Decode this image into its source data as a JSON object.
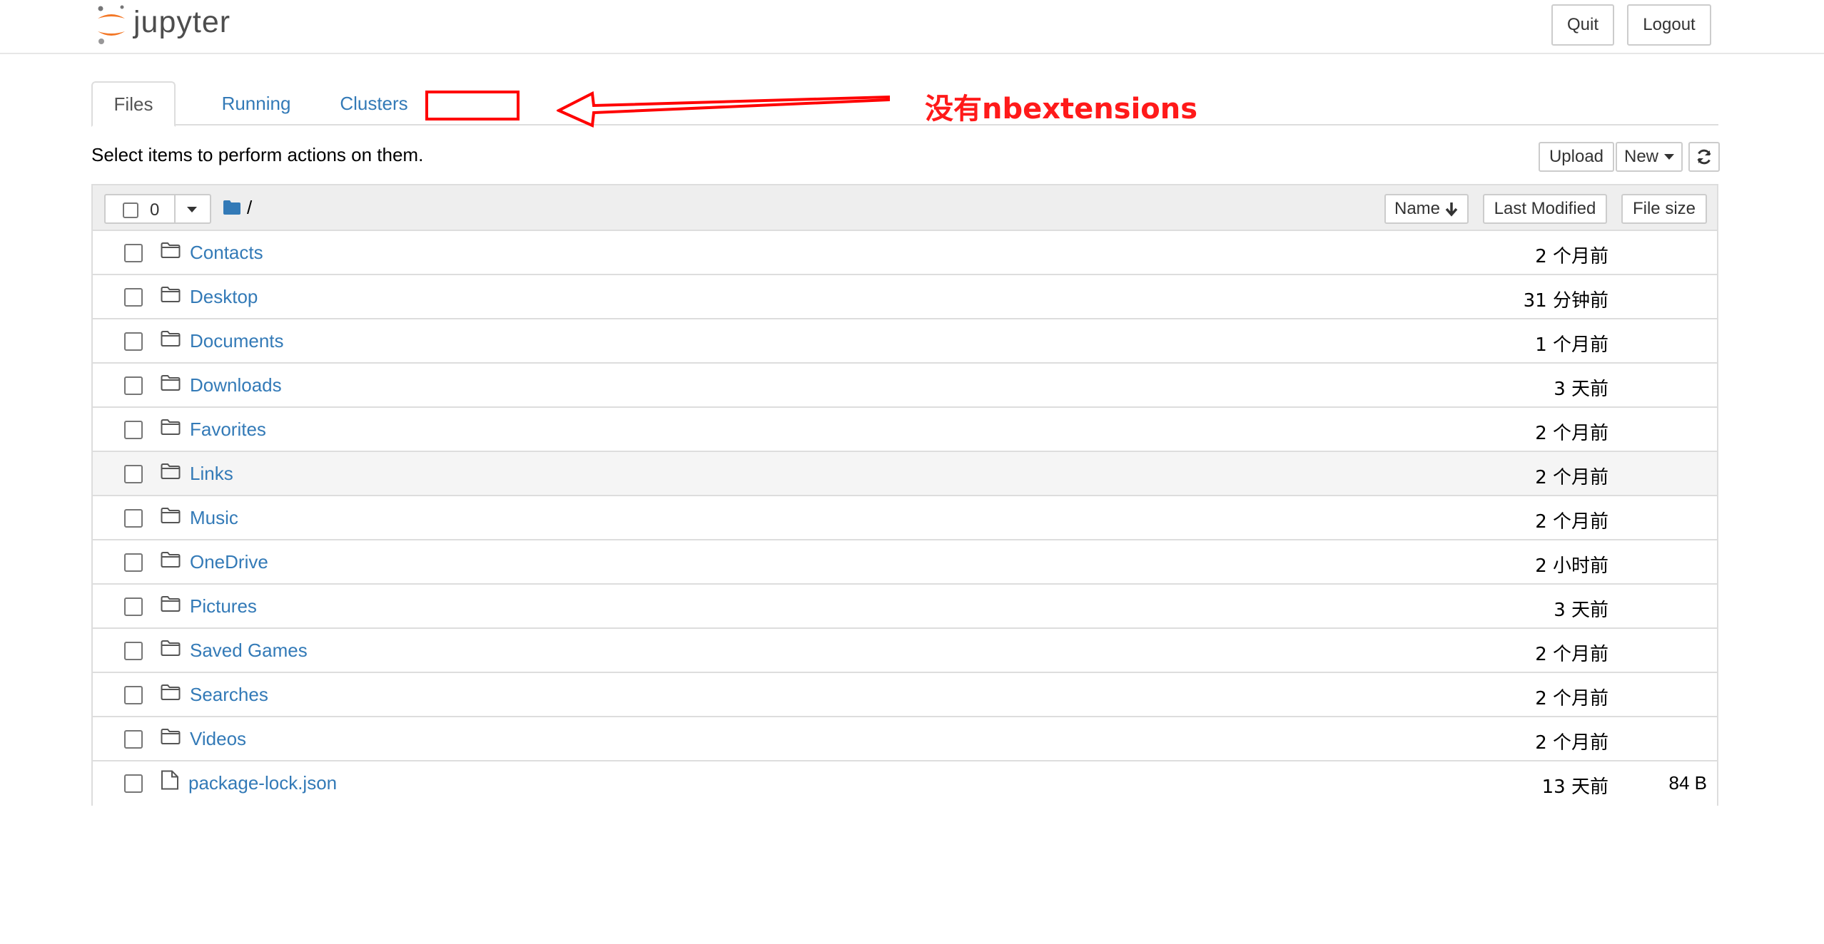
{
  "header": {
    "logo_text": "jupyter",
    "quit_label": "Quit",
    "logout_label": "Logout"
  },
  "tabs": [
    {
      "label": "Files",
      "active": true
    },
    {
      "label": "Running",
      "active": false
    },
    {
      "label": "Clusters",
      "active": false
    }
  ],
  "annotation": {
    "text": "没有nbextensions",
    "color": "#ff0000"
  },
  "toolbar": {
    "hint": "Select items to perform actions on them.",
    "upload_label": "Upload",
    "new_label": "New",
    "refresh_icon": "refresh-icon"
  },
  "list_header": {
    "selected_count": "0",
    "breadcrumb": "/",
    "sort_name_label": "Name",
    "sort_modified_label": "Last Modified",
    "sort_size_label": "File size"
  },
  "rows": [
    {
      "name": "Contacts",
      "type": "folder",
      "modified": "2 个月前",
      "size": ""
    },
    {
      "name": "Desktop",
      "type": "folder",
      "modified": "31 分钟前",
      "size": ""
    },
    {
      "name": "Documents",
      "type": "folder",
      "modified": "1 个月前",
      "size": ""
    },
    {
      "name": "Downloads",
      "type": "folder",
      "modified": "3 天前",
      "size": ""
    },
    {
      "name": "Favorites",
      "type": "folder",
      "modified": "2 个月前",
      "size": ""
    },
    {
      "name": "Links",
      "type": "folder",
      "modified": "2 个月前",
      "size": ""
    },
    {
      "name": "Music",
      "type": "folder",
      "modified": "2 个月前",
      "size": ""
    },
    {
      "name": "OneDrive",
      "type": "folder",
      "modified": "2 小时前",
      "size": ""
    },
    {
      "name": "Pictures",
      "type": "folder",
      "modified": "3 天前",
      "size": ""
    },
    {
      "name": "Saved Games",
      "type": "folder",
      "modified": "2 个月前",
      "size": ""
    },
    {
      "name": "Searches",
      "type": "folder",
      "modified": "2 个月前",
      "size": ""
    },
    {
      "name": "Videos",
      "type": "folder",
      "modified": "2 个月前",
      "size": ""
    },
    {
      "name": "package-lock.json",
      "type": "file",
      "modified": "13 天前",
      "size": "84 B"
    }
  ],
  "colors": {
    "link": "#337ab7",
    "brand_orange": "#f37726",
    "annotation_red": "#ff0000"
  }
}
